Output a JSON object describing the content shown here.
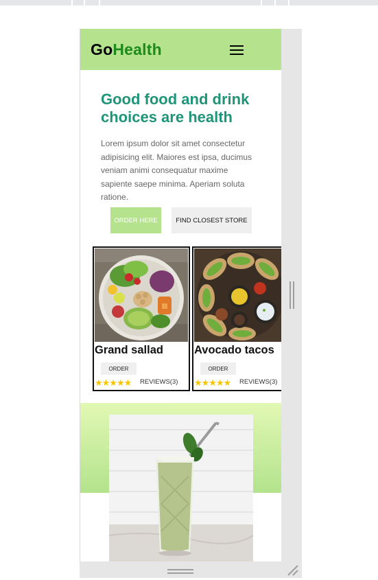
{
  "brand": {
    "logo_part1": "Go",
    "logo_part2": "Health"
  },
  "hero": {
    "title": "Good food and drink choices are health",
    "text": "Lorem ipsum dolor sit amet consectetur adipisicing elit. Maiores est ipsa, ducimus veniam animi consequatur maxime sapiente saepe minima. Aperiam soluta ratione."
  },
  "buttons": {
    "order_here": "ORDER HERE",
    "find_store": "FIND CLOSEST STORE"
  },
  "products": [
    {
      "name": "Grand sallad",
      "order_label": "ORDER",
      "stars": "★★★★★",
      "rating": 5,
      "reviews": "REVIEWS(3)"
    },
    {
      "name": "Avocado tacos",
      "order_label": "ORDER",
      "stars": "★★★★★",
      "rating": 5,
      "reviews": "REVIEWS(3)"
    }
  ],
  "colors": {
    "header": "#b5e38d",
    "title": "#1e9478",
    "logo_accent": "#1c8a1c",
    "stars": "#f5c500"
  },
  "icons": [
    "menu-icon",
    "resize-handle-icon",
    "resize-corner-icon"
  ]
}
